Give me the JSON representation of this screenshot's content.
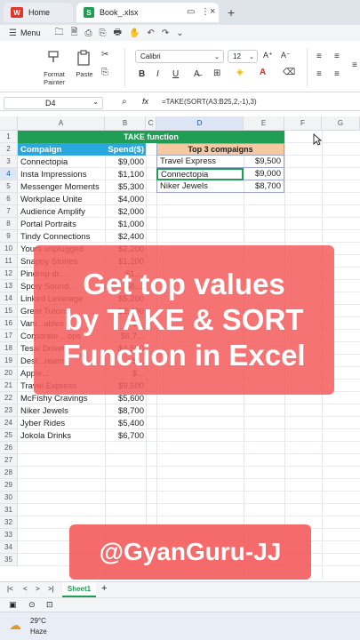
{
  "titlebar": {
    "home_tab": "Home",
    "home_logo": "W",
    "book_tab": "Book_.xlsx",
    "book_logo": "S",
    "new_tab": "+",
    "monitor_icon": "▭",
    "more_icon": "⋮",
    "close_icon": "×"
  },
  "menubar": {
    "menu_label": "Menu",
    "hamburger": "☰",
    "quick_icons": [
      "🗀",
      "🗎",
      "⎙",
      "⎘",
      "🖶",
      "✋",
      "↶",
      "↷",
      "⌄"
    ]
  },
  "ribbon": {
    "format_painter": "Format Painter",
    "format_painter_line1": "Format",
    "format_painter_line2": "Painter",
    "paste": "Paste",
    "font_name": "Calibri",
    "font_size": "12",
    "bold": "B",
    "italic": "I",
    "underline": "U",
    "grow_font": "A⁺",
    "shrink_font": "A⁻"
  },
  "formula_bar": {
    "cell_ref": "D4",
    "fx": "fx",
    "formula": "=TAKE(SORT(A3:B25,2,-1),3)"
  },
  "columns": [
    "A",
    "B",
    "C",
    "D",
    "E",
    "F",
    "G"
  ],
  "rows": [
    "1",
    "2",
    "3",
    "4",
    "5",
    "6",
    "7",
    "8",
    "9",
    "10",
    "11",
    "12",
    "13",
    "14",
    "15",
    "16",
    "17",
    "18",
    "19",
    "20",
    "21",
    "22",
    "23",
    "24",
    "25",
    "26",
    "27",
    "28",
    "29",
    "30",
    "31",
    "32",
    "33",
    "34",
    "35"
  ],
  "sheet": {
    "title": "TAKE function",
    "header_campaign": "Compaign",
    "header_spend": "Spend($)",
    "data": [
      {
        "name": "Connectopia",
        "spend": "$9,000"
      },
      {
        "name": "Insta Impressions",
        "spend": "$1,100"
      },
      {
        "name": "Messenger Moments",
        "spend": "$5,300"
      },
      {
        "name": "Workplace Unite",
        "spend": "$4,000"
      },
      {
        "name": "Audience Amplify",
        "spend": "$2,000"
      },
      {
        "name": "Portal Portraits",
        "spend": "$1,000"
      },
      {
        "name": "Tindy Connections",
        "spend": "$2,400"
      },
      {
        "name": "Yours unplugged",
        "spend": "$2,200"
      },
      {
        "name": "Snappy Stories",
        "spend": "$1,200"
      },
      {
        "name": "Pindrop dr...",
        "spend": "$1,..."
      },
      {
        "name": "Spoty Sound...",
        "spend": "$8,..."
      },
      {
        "name": "Linked Leverage",
        "spend": "$5,200"
      },
      {
        "name": "Great Tutorial",
        "spend": "$2,400"
      },
      {
        "name": "Vani...ables",
        "spend": "$..."
      },
      {
        "name": "Corporate ...ops",
        "spend": "$6,7..."
      },
      {
        "name": "Tesai Drivers",
        "spend": "$4,500"
      },
      {
        "name": "Dest...reams",
        "spend": "$..."
      },
      {
        "name": "Apple...",
        "spend": "$..."
      },
      {
        "name": "Travel Express",
        "spend": "$9,500"
      },
      {
        "name": "McFishy Cravings",
        "spend": "$5,600"
      },
      {
        "name": "Niker Jewels",
        "spend": "$8,700"
      },
      {
        "name": "Jyber Rides",
        "spend": "$5,400"
      },
      {
        "name": "Jokola Drinks",
        "spend": "$6,700"
      }
    ],
    "top_title": "Top 3 compaigns",
    "top": [
      {
        "name": "Travel Express",
        "spend": "$9,500"
      },
      {
        "name": "Connectopia",
        "spend": "$9,000"
      },
      {
        "name": "Niker Jewels",
        "spend": "$8,700"
      }
    ]
  },
  "overlay": {
    "line1": "Get top values",
    "line2": "by TAKE & SORT",
    "line3": "Function in Excel",
    "handle": "@GyanGuru-JJ"
  },
  "sheetbar": {
    "first": "|<",
    "prev": "<",
    "next": ">",
    "last": ">|",
    "sheet_tab": "Sheet1",
    "add_sheet": "+"
  },
  "taskbar": {
    "temperature": "29°C",
    "condition": "Haze"
  },
  "colors": {
    "title_green": "#1f9d55",
    "header_blue": "#29a8e0",
    "top_header_orange": "#f6c9a2",
    "overlay_red": "#f45a5a"
  }
}
